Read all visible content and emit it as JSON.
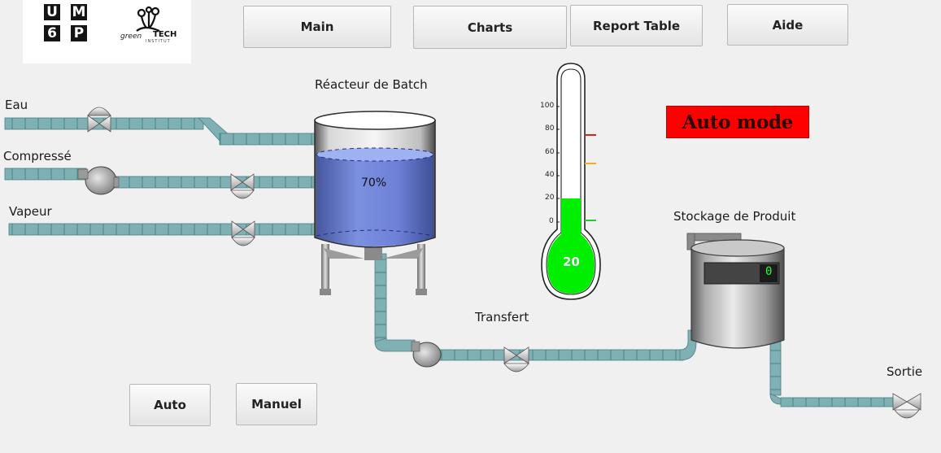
{
  "branding": {
    "um6p_letters": [
      "U",
      "M",
      "6",
      "P"
    ],
    "institute_words": [
      "green",
      "TECH",
      "INSTITUT"
    ]
  },
  "nav": {
    "main": "Main",
    "charts": "Charts",
    "report_table": "Report Table",
    "aide": "Aide"
  },
  "process": {
    "reactor_title": "Réacteur de Batch",
    "reactor_level": "70%",
    "reactor_level_fraction": 0.7,
    "inlet_eau": "Eau",
    "inlet_compresse": "Compressé",
    "inlet_vapeur": "Vapeur",
    "transfer_label": "Transfert",
    "storage_title": "Stockage de Produit",
    "storage_display": "0",
    "outlet_label": "Sortie"
  },
  "thermometer": {
    "value": "20",
    "ticks": [
      "100",
      "80",
      "60",
      "40",
      "20",
      "0"
    ],
    "fill_fraction": 0.2,
    "high_alarm_color": "#e02020",
    "warn_color": "#f0b020",
    "low_color": "#20d020",
    "fluid_color": "#00ee00"
  },
  "mode": {
    "status": "Auto mode",
    "color": "#ff0000"
  },
  "controls": {
    "auto": "Auto",
    "manuel": "Manuel"
  }
}
